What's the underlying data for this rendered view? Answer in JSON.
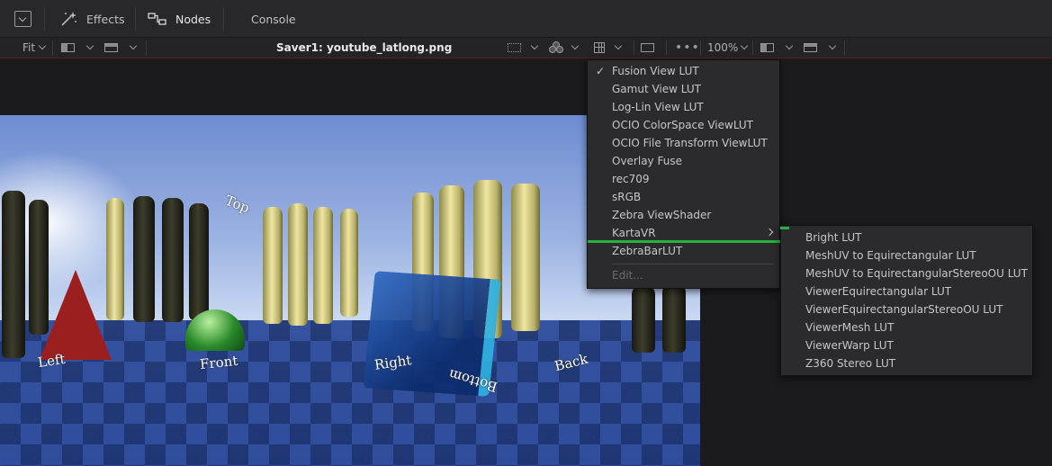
{
  "toolbar": {
    "effects_label": "Effects",
    "nodes_label": "Nodes",
    "console_label": "Console"
  },
  "viewer_toolbar": {
    "fit_label": "Fit",
    "title": "Saver1: youtube_latlong.png",
    "zoom_label": "100%"
  },
  "scene_labels": {
    "top": "Top",
    "left": "Left",
    "front": "Front",
    "right": "Right",
    "bottom": "Bottom",
    "back": "Back"
  },
  "lut_menu": {
    "items": [
      {
        "label": "Fusion View LUT",
        "checked": true
      },
      {
        "label": "Gamut View LUT"
      },
      {
        "label": "Log-Lin View LUT"
      },
      {
        "label": "OCIO ColorSpace ViewLUT"
      },
      {
        "label": "OCIO File Transform ViewLUT"
      },
      {
        "label": "Overlay Fuse"
      },
      {
        "label": "rec709"
      },
      {
        "label": "sRGB"
      },
      {
        "label": "Zebra ViewShader"
      },
      {
        "label": "KartaVR",
        "submenu": true
      },
      {
        "label": "ZebraBarLUT"
      },
      {
        "label": "Edit...",
        "disabled": true
      }
    ]
  },
  "kartavr_submenu": {
    "items": [
      "Bright LUT",
      "MeshUV to Equirectangular LUT",
      "MeshUV to EquirectangularStereoOU LUT",
      "ViewerEquirectangular LUT",
      "ViewerEquirectangularStereoOU LUT",
      "ViewerMesh LUT",
      "ViewerWarp LUT",
      "Z360 Stereo LUT"
    ]
  },
  "colors": {
    "highlight_underline": "#27b040",
    "toolbar_bg": "#28282a",
    "menu_bg": "#2b2b2d"
  }
}
